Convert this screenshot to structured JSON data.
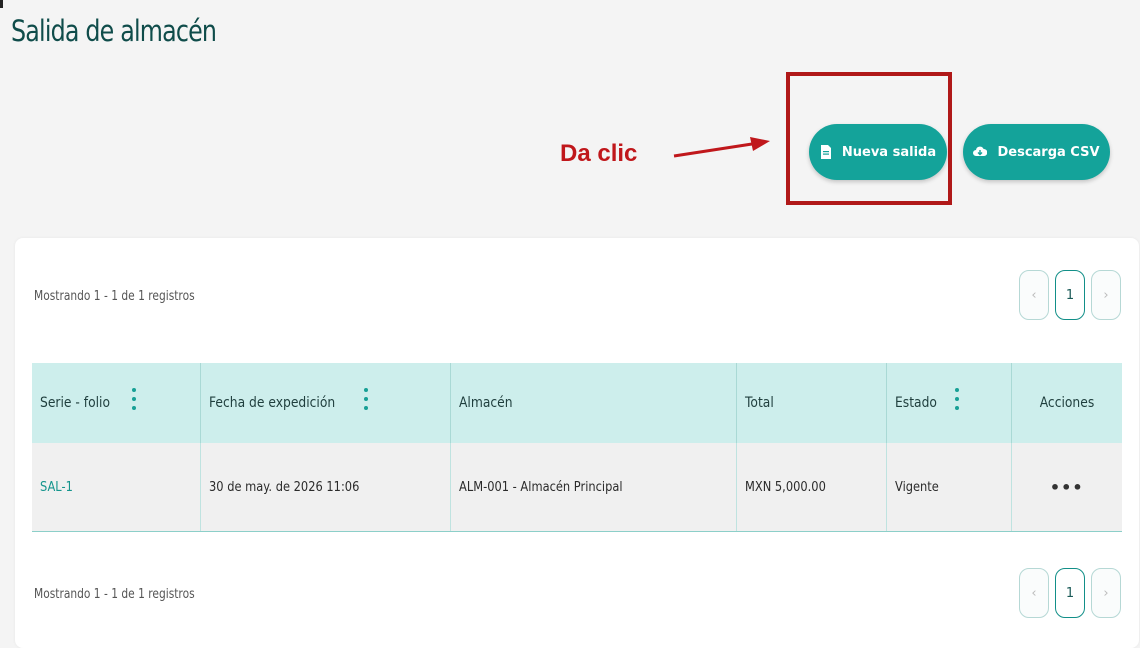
{
  "header": {
    "title": "Salida de almacén"
  },
  "toolbar": {
    "new_label": "Nueva salida",
    "csv_label": "Descarga CSV"
  },
  "annotation": {
    "callout": "Da clic",
    "color": "#c0171b"
  },
  "pagination": {
    "summary_top": "Mostrando 1 - 1 de 1 registros",
    "summary_bottom": "Mostrando 1 - 1 de 1 registros",
    "prev": "‹",
    "current": "1",
    "next": "›"
  },
  "table": {
    "columns": [
      "Serie - folio",
      "Fecha de expedición",
      "Almacén",
      "Total",
      "Estado",
      "Acciones"
    ],
    "rows": [
      {
        "folio": "SAL-1",
        "fecha": "30 de may. de 2026 11:06",
        "almacen": "ALM-001 - Almacén Principal",
        "total": "MXN 5,000.00",
        "estado": "Vigente",
        "acciones": "•••"
      }
    ]
  },
  "colors": {
    "accent": "#14a39a",
    "header_bg": "#cdeeec",
    "title": "#0f4c4a"
  },
  "icons": {
    "new": "document-icon",
    "csv": "cloud-download-icon",
    "sort": "sort-dots-icon",
    "actions": "more-horizontal-icon"
  }
}
